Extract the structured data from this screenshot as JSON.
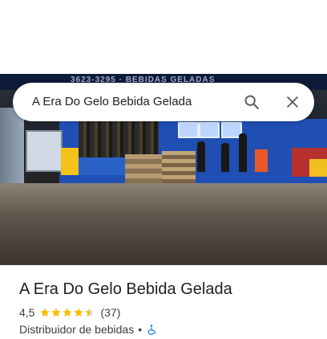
{
  "search": {
    "query": "A Era Do Gelo Bebida Gelada",
    "search_icon": "search-icon",
    "close_icon": "close-icon"
  },
  "place": {
    "name": "A Era Do Gelo Bebida Gelada",
    "rating": "4,5",
    "rating_value": 4.5,
    "review_count": "(37)",
    "category": "Distribuidor de bebidas",
    "separator": "•",
    "accessibility_icon": "wheelchair-accessible-icon"
  },
  "photo": {
    "sign_text": "3623-3295 · BEBIDAS GELADAS"
  },
  "colors": {
    "star": "#fbbc04",
    "star_empty": "#dadce0",
    "accessible_icon": "#1a73e8",
    "text_primary": "#202124",
    "text_secondary": "#3c4043"
  }
}
